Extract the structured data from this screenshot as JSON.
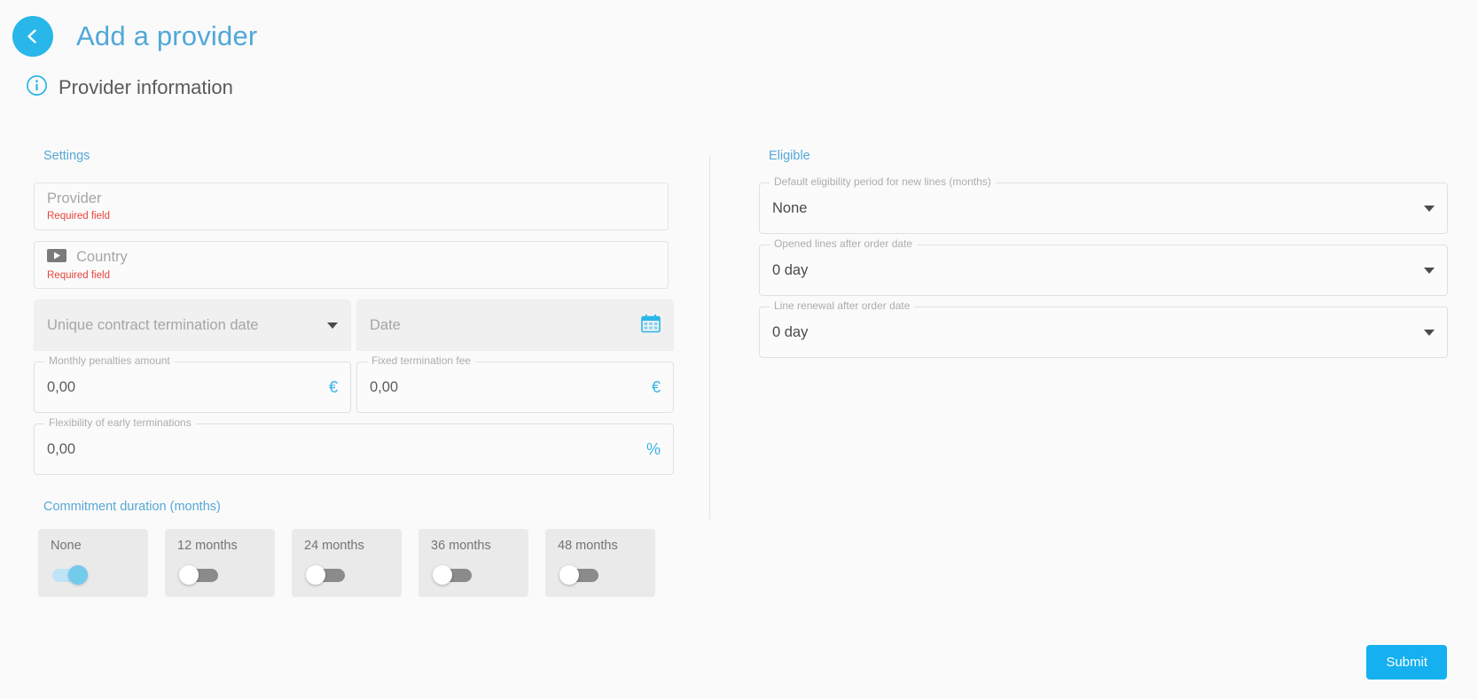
{
  "header": {
    "back_icon": "chevron-left-icon",
    "title": "Add a provider",
    "info_icon": "info-circle-icon",
    "section_title": "Provider information"
  },
  "colors": {
    "accent": "#29b6e8",
    "title_blue": "#4fa8d8",
    "group_blue": "#57a8d6",
    "error_red": "#e8453c",
    "submit_blue": "#14b0ef",
    "toggle_on": "#73cbec",
    "toggle_off": "#8b8b8b"
  },
  "settings": {
    "group_label": "Settings",
    "provider": {
      "placeholder": "Provider",
      "error": "Required field"
    },
    "country": {
      "placeholder": "Country",
      "error": "Required field",
      "icon": "flag-icon"
    },
    "termination_select": {
      "placeholder": "Unique contract termination date",
      "icon": "chevron-down-icon"
    },
    "termination_date": {
      "placeholder": "Date",
      "icon": "calendar-icon"
    },
    "monthly_penalties": {
      "label": "Monthly penalties amount",
      "value": "0,00",
      "suffix": "€"
    },
    "fixed_fee": {
      "label": "Fixed termination fee",
      "value": "0,00",
      "suffix": "€"
    },
    "flexibility": {
      "label": "Flexibility of early terminations",
      "value": "0,00",
      "suffix": "%"
    }
  },
  "eligible": {
    "group_label": "Eligible",
    "fields": [
      {
        "label": "Default eligibility period for new lines (months)",
        "value": "None",
        "icon": "chevron-down-icon"
      },
      {
        "label": "Opened lines after order date",
        "value": "0 day",
        "icon": "chevron-down-icon"
      },
      {
        "label": "Line renewal after order date",
        "value": "0 day",
        "icon": "chevron-down-icon"
      }
    ]
  },
  "commitment": {
    "label": "Commitment duration (months)",
    "options": [
      {
        "label": "None",
        "on": true
      },
      {
        "label": "12 months",
        "on": false
      },
      {
        "label": "24 months",
        "on": false
      },
      {
        "label": "36 months",
        "on": false
      },
      {
        "label": "48 months",
        "on": false
      }
    ]
  },
  "footer": {
    "submit_label": "Submit"
  }
}
